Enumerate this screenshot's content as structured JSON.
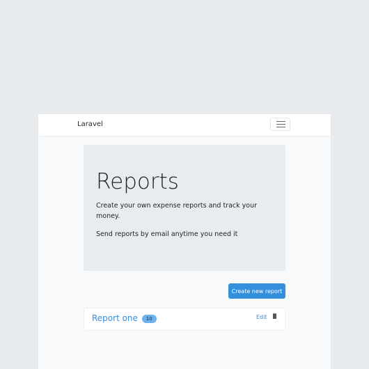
{
  "navbar": {
    "brand": "Laravel",
    "toggler_icon": "hamburger-icon"
  },
  "jumbotron": {
    "title": "Reports",
    "lead": "Create your own expense reports and track your money.",
    "text": "Send reports by email anytime you need it"
  },
  "actions": {
    "create_label": "Create new report"
  },
  "reports": [
    {
      "title": "Report one",
      "count": "10",
      "edit_label": "Edit",
      "delete_icon": "trash-icon"
    }
  ],
  "colors": {
    "primary": "#3490dc",
    "badge": "#6cb2eb"
  }
}
